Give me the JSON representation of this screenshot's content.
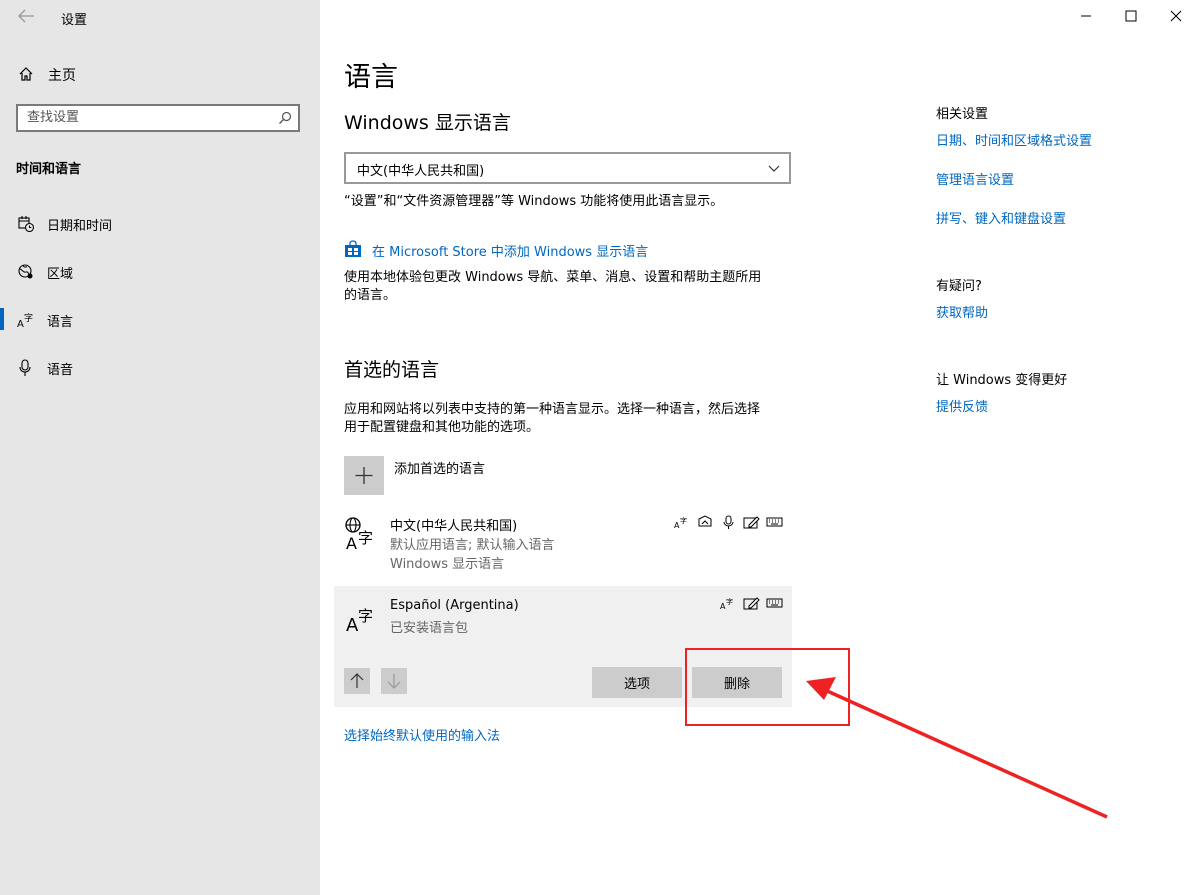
{
  "window": {
    "app_title": "设置",
    "colors": {
      "accent": "#0067c0",
      "sidebar_bg": "#e6e6e6",
      "annotation": "#ee2222"
    }
  },
  "sidebar": {
    "home_label": "主页",
    "search_placeholder": "查找设置",
    "section_title": "时间和语言",
    "items": [
      {
        "label": "日期和时间",
        "icon": "calendar-clock-icon"
      },
      {
        "label": "区域",
        "icon": "globe-region-icon"
      },
      {
        "label": "语言",
        "icon": "language-icon",
        "active": true
      },
      {
        "label": "语音",
        "icon": "microphone-icon"
      }
    ]
  },
  "main": {
    "title": "语言",
    "display_language": {
      "heading": "Windows 显示语言",
      "selected": "中文(中华人民共和国)",
      "description": "“设置”和“文件资源管理器”等 Windows 功能将使用此语言显示。",
      "store_link": "在 Microsoft Store 中添加 Windows 显示语言",
      "store_description_line1": "使用本地体验包更改 Windows 导航、菜单、消息、设置和帮助主题所用",
      "store_description_line2": "的语言。"
    },
    "preferred": {
      "heading": "首选的语言",
      "description_line1": "应用和网站将以列表中支持的第一种语言显示。选择一种语言，然后选择",
      "description_line2": "用于配置键盘和其他功能的选项。",
      "add_label": "添加首选的语言",
      "languages": [
        {
          "name": "中文(中华人民共和国)",
          "line1": "默认应用语言; 默认输入语言",
          "line2": "Windows 显示语言"
        },
        {
          "name": "Español (Argentina)",
          "line1": "已安装语言包"
        }
      ],
      "options_button": "选项",
      "remove_button": "删除"
    },
    "input_method_link": "选择始终默认使用的输入法"
  },
  "related": {
    "heading": "相关设置",
    "links": [
      "日期、时间和区域格式设置",
      "管理语言设置",
      "拼写、键入和键盘设置"
    ],
    "question_heading": "有疑问?",
    "help_link": "获取帮助",
    "improve_heading": "让 Windows 变得更好",
    "feedback_link": "提供反馈"
  }
}
